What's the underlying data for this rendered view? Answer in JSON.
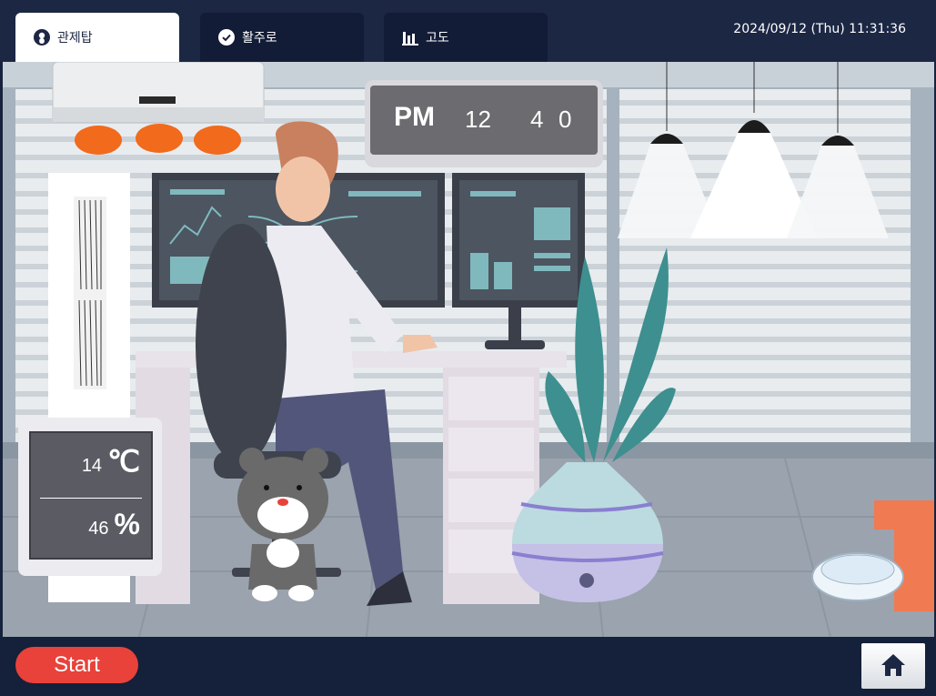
{
  "tabs": [
    {
      "label": "관제탑",
      "icon": "person-icon",
      "active": true
    },
    {
      "label": "활주로",
      "icon": "check-circle-icon",
      "active": false
    },
    {
      "label": "고도",
      "icon": "bar-chart-icon",
      "active": false
    }
  ],
  "datetime": "2024/09/12 (Thu) 11:31:36",
  "timer": {
    "ampm": "PM",
    "hour": "12",
    "minute_tens": "4",
    "minute_ones": "0"
  },
  "readouts": {
    "temperature": {
      "value": "14",
      "unit": "℃"
    },
    "humidity": {
      "value": "46",
      "unit": "%"
    }
  },
  "bottom": {
    "start_label": "Start",
    "home_icon": "home-icon"
  },
  "colors": {
    "header": "#1c2744",
    "start": "#e8423a",
    "panel": "#5a5b63"
  }
}
